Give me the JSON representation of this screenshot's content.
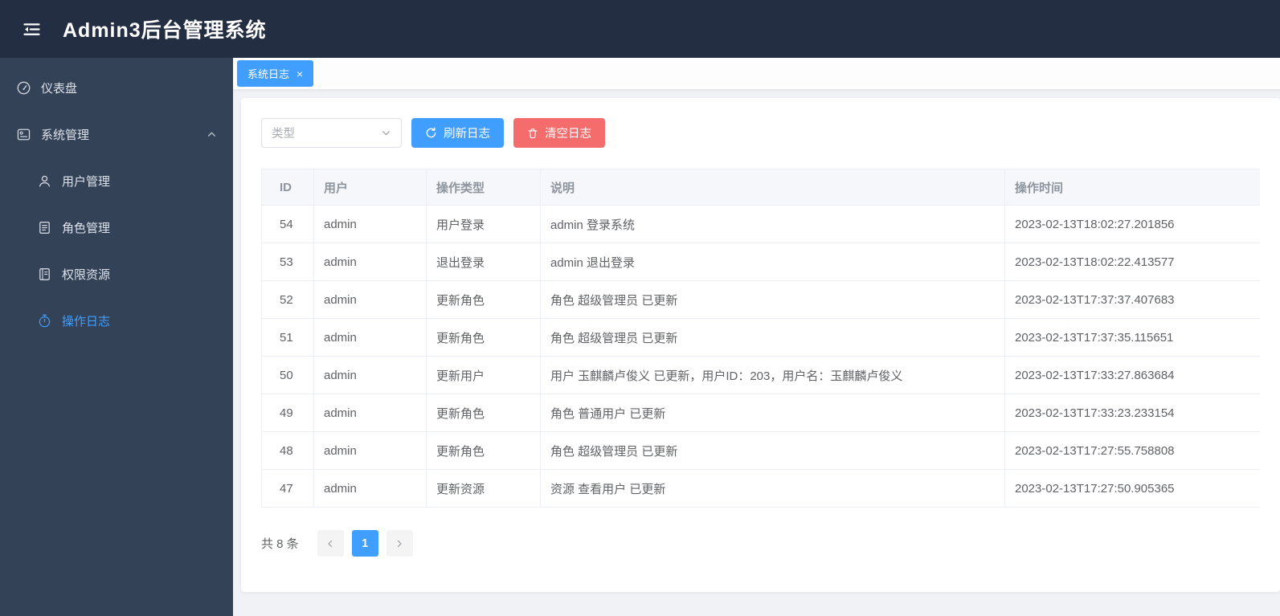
{
  "app": {
    "title": "Admin3后台管理系统"
  },
  "sidebar": {
    "items": [
      {
        "label": "仪表盘",
        "icon": "dashboard-icon",
        "active": false
      },
      {
        "label": "系统管理",
        "icon": "system-icon",
        "active": false,
        "expanded": true
      },
      {
        "label": "用户管理",
        "icon": "user-icon",
        "active": false
      },
      {
        "label": "角色管理",
        "icon": "role-icon",
        "active": false
      },
      {
        "label": "权限资源",
        "icon": "resource-icon",
        "active": false
      },
      {
        "label": "操作日志",
        "icon": "stopwatch-icon",
        "active": true
      }
    ]
  },
  "tabbar": {
    "active_tab": "系统日志",
    "close_icon": "×"
  },
  "toolbar": {
    "type_select": {
      "placeholder": "类型",
      "value": ""
    },
    "refresh_label": "刷新日志",
    "clear_label": "清空日志"
  },
  "table": {
    "columns": [
      "ID",
      "用户",
      "操作类型",
      "说明",
      "操作时间"
    ],
    "rows": [
      [
        "54",
        "admin",
        "用户登录",
        "admin 登录系统",
        "2023-02-13T18:02:27.201856"
      ],
      [
        "53",
        "admin",
        "退出登录",
        "admin 退出登录",
        "2023-02-13T18:02:22.413577"
      ],
      [
        "52",
        "admin",
        "更新角色",
        "角色 超级管理员 已更新",
        "2023-02-13T17:37:37.407683"
      ],
      [
        "51",
        "admin",
        "更新角色",
        "角色 超级管理员 已更新",
        "2023-02-13T17:37:35.115651"
      ],
      [
        "50",
        "admin",
        "更新用户",
        "用户 玉麒麟卢俊义 已更新，用户ID：203，用户名：玉麒麟卢俊义",
        "2023-02-13T17:33:27.863684"
      ],
      [
        "49",
        "admin",
        "更新角色",
        "角色 普通用户 已更新",
        "2023-02-13T17:33:23.233154"
      ],
      [
        "48",
        "admin",
        "更新角色",
        "角色 超级管理员 已更新",
        "2023-02-13T17:27:55.758808"
      ],
      [
        "47",
        "admin",
        "更新资源",
        "资源 查看用户 已更新",
        "2023-02-13T17:27:50.905365"
      ]
    ]
  },
  "pagination": {
    "total_label": "共 8 条",
    "page": "1"
  },
  "colors": {
    "primary": "#409eff",
    "danger": "#f56c6c",
    "header_bg": "#242e42",
    "sidebar_bg": "#344258",
    "content_bg": "#f0f2f5",
    "table_header_bg": "#f5f7fa",
    "table_border": "#ebeef5"
  }
}
